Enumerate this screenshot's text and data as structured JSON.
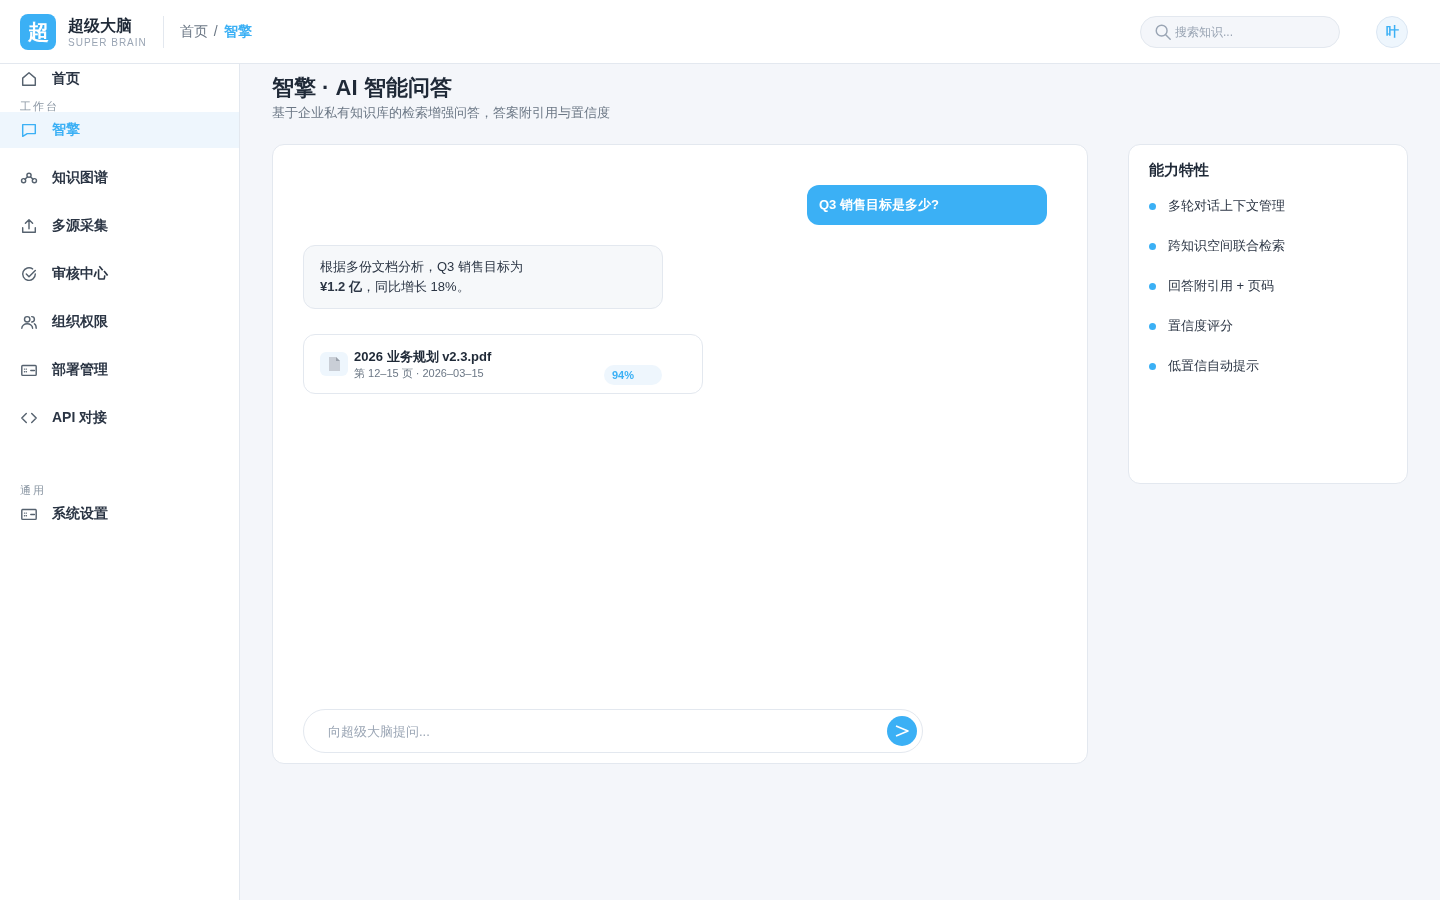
{
  "header": {
    "logo_mark": "超",
    "brand": "超级大脑",
    "brand_sub": "SUPER BRAIN",
    "breadcrumb": [
      {
        "label": "首页",
        "selected": false
      },
      {
        "label": "智擎",
        "selected": true
      }
    ],
    "breadcrumb_separator": "/",
    "search": {
      "placeholder": "搜索知识..."
    },
    "avatar": "叶"
  },
  "sidebar": {
    "sections": [
      {
        "items": [
          {
            "label": "首页",
            "selected": false
          }
        ]
      },
      {
        "title": "工作台",
        "items": [
          {
            "label": "智擎",
            "selected": true
          },
          {
            "label": "知识图谱",
            "selected": false
          },
          {
            "label": "多源采集",
            "selected": false
          },
          {
            "label": "审核中心",
            "selected": false
          },
          {
            "label": "组织权限",
            "selected": false
          },
          {
            "label": "部署管理",
            "selected": false
          },
          {
            "label": "API 对接",
            "selected": false
          }
        ]
      },
      {
        "title": "通用",
        "items": [
          {
            "label": "系统设置",
            "selected": false
          }
        ]
      }
    ]
  },
  "page": {
    "title": "智擎 · AI 智能问答",
    "subtitle": "基于企业私有知识库的检索增强问答，答案附引用与置信度"
  },
  "chat": {
    "messages": [
      {
        "kind": "user",
        "text": "Q3 销售目标是多少?"
      },
      {
        "kind": "answer",
        "text": "根据多份文档分析，Q3 销售目标为\n**¥1.2 亿**，同比增长 18%。"
      },
      {
        "kind": "source",
        "title": "2026 业务规划 v2.3.pdf",
        "meta": "第 12–15 页 · 2026–03–15",
        "score": "94%"
      }
    ],
    "input": {
      "placeholder": "向超级大脑提问..."
    }
  },
  "features": {
    "title": "能力特性",
    "items": [
      {
        "label": "多轮对话上下文管理",
        "color": "#3bb0f5"
      },
      {
        "label": "跨知识空间联合检索",
        "color": "#3bb0f5"
      },
      {
        "label": "回答附引用 + 页码",
        "color": "#3bb0f5"
      },
      {
        "label": "置信度评分",
        "color": "#3bb0f5"
      },
      {
        "label": "低置信自动提示",
        "color": "#3bb0f5"
      }
    ]
  }
}
